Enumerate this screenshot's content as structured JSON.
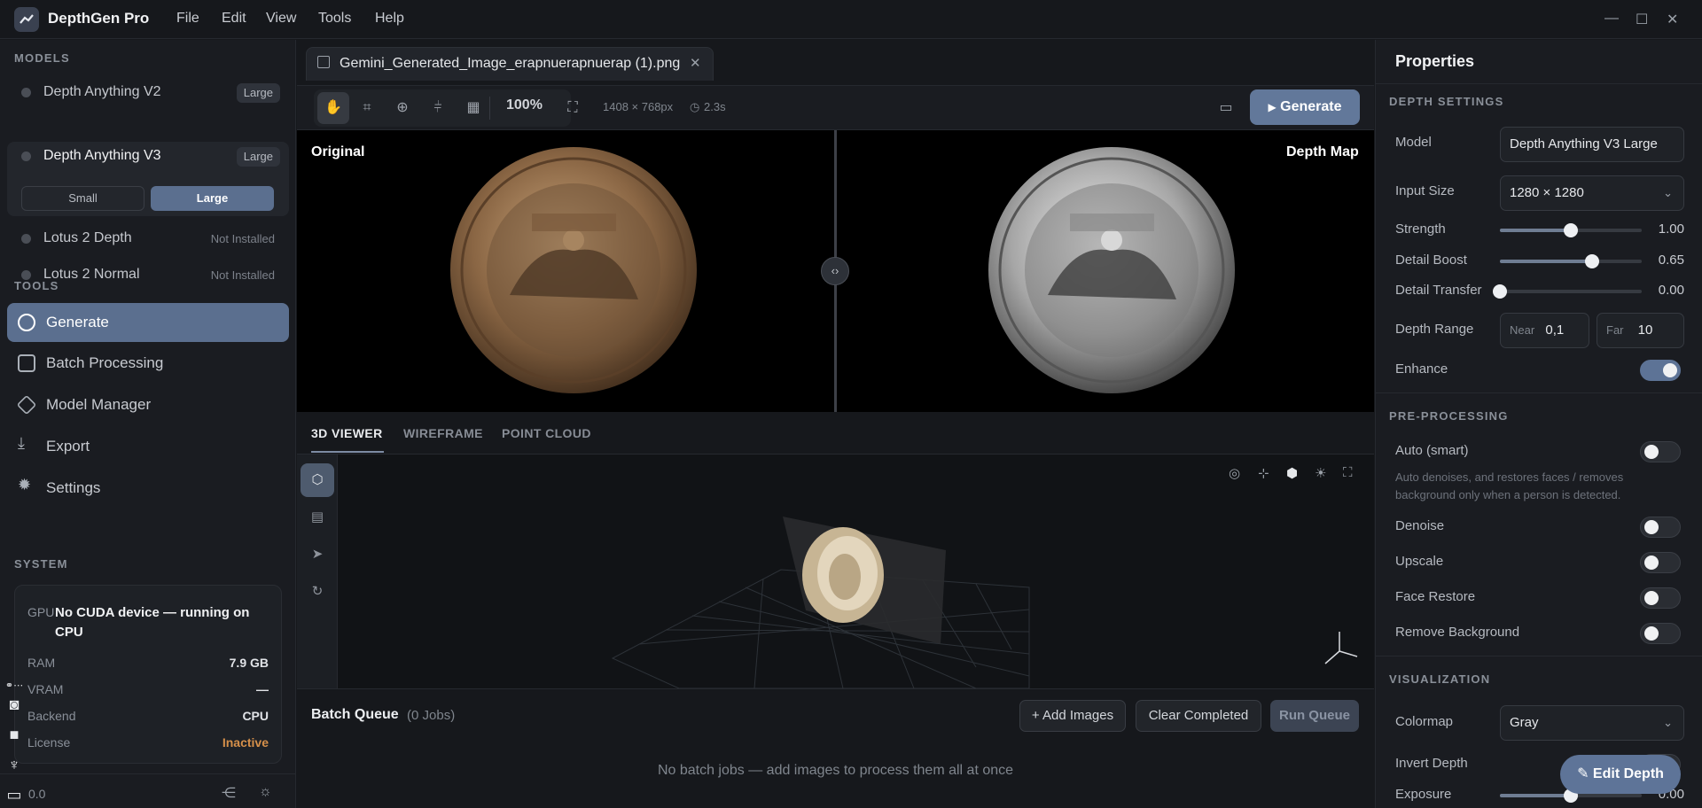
{
  "app": {
    "name": "DepthGen Pro",
    "menu": [
      "File",
      "Edit",
      "View",
      "Tools",
      "Help"
    ]
  },
  "window": {
    "minimize": "—",
    "maximize": "☐",
    "close": "✕"
  },
  "sidebar": {
    "models_label": "MODELS",
    "models": [
      {
        "name": "Depth Anything V2",
        "status": "Large"
      },
      {
        "name": "Depth Anything V3",
        "status": "Large",
        "sizes": [
          "Small",
          "Large"
        ],
        "selected_size": "Large"
      },
      {
        "name": "Lotus 2 Depth",
        "status": "Not Installed"
      },
      {
        "name": "Lotus 2 Normal",
        "status": "Not Installed"
      }
    ],
    "tools_label": "TOOLS",
    "tools": [
      "Generate",
      "Batch Processing",
      "Model Manager",
      "Export",
      "Settings"
    ],
    "system_label": "SYSTEM",
    "system": {
      "gpu_key": "GPU",
      "gpu_value": "No CUDA device — running on CPU",
      "ram_key": "RAM",
      "ram_value": "7.9 GB",
      "vram_key": "VRAM",
      "vram_value": "—",
      "backend_key": "Backend",
      "backend_value": "CPU",
      "license_key": "License",
      "license_value": "Inactive"
    },
    "version": "0.0"
  },
  "file_tab": {
    "name": "Gemini_Generated_Image_erapnuerapnuerap (1).png"
  },
  "toolbar": {
    "zoom": "100%",
    "dimensions": "1408 × 768px",
    "time": "2.3s",
    "generate": "Generate"
  },
  "compare": {
    "left_label": "Original",
    "right_label": "Depth Map"
  },
  "viewer_tabs": [
    "3D VIEWER",
    "WIREFRAME",
    "POINT CLOUD"
  ],
  "batch": {
    "title": "Batch Queue",
    "count": "(0 Jobs)",
    "add": "+ Add Images",
    "clear": "Clear Completed",
    "run": "Run Queue",
    "empty": "No batch jobs — add images to process them all at once"
  },
  "props": {
    "title": "Properties",
    "depth_settings_label": "DEPTH SETTINGS",
    "model_label": "Model",
    "model_value": "Depth Anything V3 Large",
    "input_size_label": "Input Size",
    "input_size_value": "1280 × 1280",
    "strength_label": "Strength",
    "strength_value": "1.00",
    "detail_boost_label": "Detail Boost",
    "detail_boost_value": "0.65",
    "detail_transfer_label": "Detail Transfer",
    "detail_transfer_value": "0.00",
    "depth_range_label": "Depth Range",
    "near_label": "Near",
    "near_value": "0,1",
    "far_label": "Far",
    "far_value": "10",
    "enhance_label": "Enhance",
    "preprocessing_label": "PRE-PROCESSING",
    "auto_label": "Auto (smart)",
    "auto_hint": "Auto denoises, and restores faces / removes background only when a person is detected.",
    "denoise_label": "Denoise",
    "upscale_label": "Upscale",
    "face_restore_label": "Face Restore",
    "remove_bg_label": "Remove Background",
    "visualization_label": "VISUALIZATION",
    "colormap_label": "Colormap",
    "colormap_value": "Gray",
    "invert_label": "Invert Depth",
    "exposure_label": "Exposure",
    "exposure_value": "0.00",
    "edit_depth": "Edit Depth"
  },
  "slider_levels": {
    "strength": 0.5,
    "detail_boost": 0.65,
    "detail_transfer": 0.0,
    "exposure": 0.5
  },
  "colors": {
    "accent": "#5b6f8f",
    "background": "#16181c",
    "inactive": "#d6904a"
  }
}
